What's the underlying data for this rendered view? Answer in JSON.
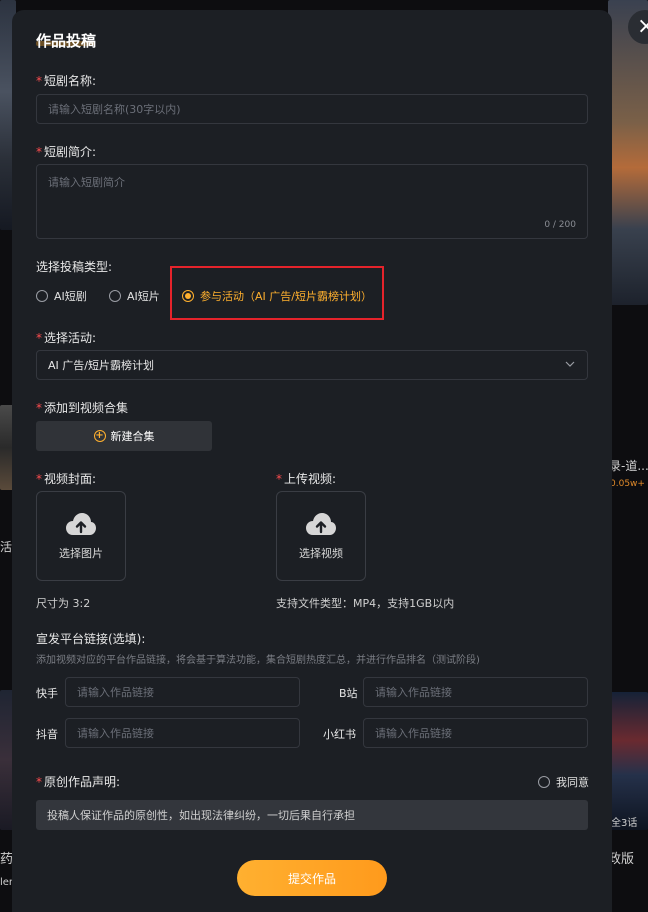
{
  "modal": {
    "title": "作品投稿",
    "close_icon": "×"
  },
  "fields": {
    "name": {
      "label": "短剧名称:",
      "placeholder": "请输入短剧名称(30字以内)"
    },
    "intro": {
      "label": "短剧简介:",
      "placeholder": "请输入短剧简介",
      "counter": "0 / 200"
    },
    "type": {
      "label": "选择投稿类型:",
      "options": [
        "AI短剧",
        "AI短片",
        "参与活动（AI 广告/短片霸榜计划）"
      ],
      "selected_index": 2
    },
    "activity": {
      "label": "选择活动:",
      "value": "AI 广告/短片霸榜计划"
    },
    "collection": {
      "label": "添加到视频合集",
      "button": "新建合集"
    },
    "cover": {
      "label": "视频封面:",
      "button": "选择图片",
      "hint": "尺寸为 3:2"
    },
    "video": {
      "label": "上传视频:",
      "button": "选择视频",
      "hint": "支持文件类型：MP4，支持1GB以内"
    },
    "platforms": {
      "label": "宣发平台链接(选填):",
      "desc": "添加视频对应的平台作品链接，将会基于算法功能，集合短剧热度汇总，并进行作品排名（测试阶段)",
      "items": [
        {
          "name": "快手",
          "placeholder": "请输入作品链接"
        },
        {
          "name": "B站",
          "placeholder": "请输入作品链接"
        },
        {
          "name": "抖音",
          "placeholder": "请输入作品链接"
        },
        {
          "name": "小红书",
          "placeholder": "请输入作品链接"
        }
      ]
    },
    "declaration": {
      "label": "原创作品声明:",
      "agree": "我同意",
      "text": "投稿人保证作品的原创性，如出现法律纠纷，一切后果自行承担"
    }
  },
  "submit_label": "提交作品",
  "background": {
    "right_title": "录-道...",
    "right_hot": "0.05w+",
    "left_frag1": "活把",
    "left_frag2": "药",
    "left_frag3": "ler",
    "right_frag1": "全3话",
    "right_frag2": "政版"
  },
  "colors": {
    "accent": "#ffb02e",
    "required": "#ff4d4f",
    "highlight": "#e5232b",
    "modal_bg": "#1c1f24"
  },
  "icons": [
    "close-icon",
    "chevron-down-icon",
    "plus-circle-icon",
    "cloud-upload-icon"
  ]
}
